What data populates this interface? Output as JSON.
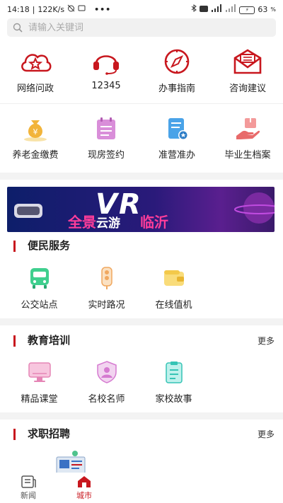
{
  "status_bar": {
    "time": "14:18",
    "speed": "122K/s",
    "battery": "63"
  },
  "search": {
    "placeholder": "请输入关键词"
  },
  "top_services": [
    {
      "icon": "cloud-star-icon",
      "label": "网络问政"
    },
    {
      "icon": "headset-icon",
      "label": "12345"
    },
    {
      "icon": "compass-icon",
      "label": "办事指南"
    },
    {
      "icon": "mail-icon",
      "label": "咨询建议"
    }
  ],
  "secondary_services": [
    {
      "icon": "money-bag-icon",
      "label": "养老金缴费"
    },
    {
      "icon": "calendar-icon",
      "label": "现房签约"
    },
    {
      "icon": "document-badge-icon",
      "label": "准营准办"
    },
    {
      "icon": "hand-box-icon",
      "label": "毕业生档案"
    }
  ],
  "banner": {
    "big": "VR",
    "t1": "全景",
    "t2": "云游",
    "t3": "临沂"
  },
  "sections": {
    "convenience": {
      "title": "便民服务",
      "items": [
        {
          "icon": "bus-icon",
          "label": "公交站点"
        },
        {
          "icon": "traffic-light-icon",
          "label": "实时路况"
        },
        {
          "icon": "wallet-icon",
          "label": "在线值机"
        }
      ]
    },
    "education": {
      "title": "教育培训",
      "more": "更多",
      "items": [
        {
          "icon": "monitor-icon",
          "label": "精品课堂"
        },
        {
          "icon": "teacher-shield-icon",
          "label": "名校名师"
        },
        {
          "icon": "clipboard-icon",
          "label": "家校故事"
        }
      ]
    },
    "jobs": {
      "title": "求职招聘",
      "more": "更多"
    }
  },
  "tabs": [
    {
      "icon": "news-icon",
      "label": "新闻",
      "active": false
    },
    {
      "icon": "city-icon",
      "label": "城市",
      "active": true
    }
  ],
  "colors": {
    "accent": "#c8171e",
    "band": "#f3f3f3"
  }
}
